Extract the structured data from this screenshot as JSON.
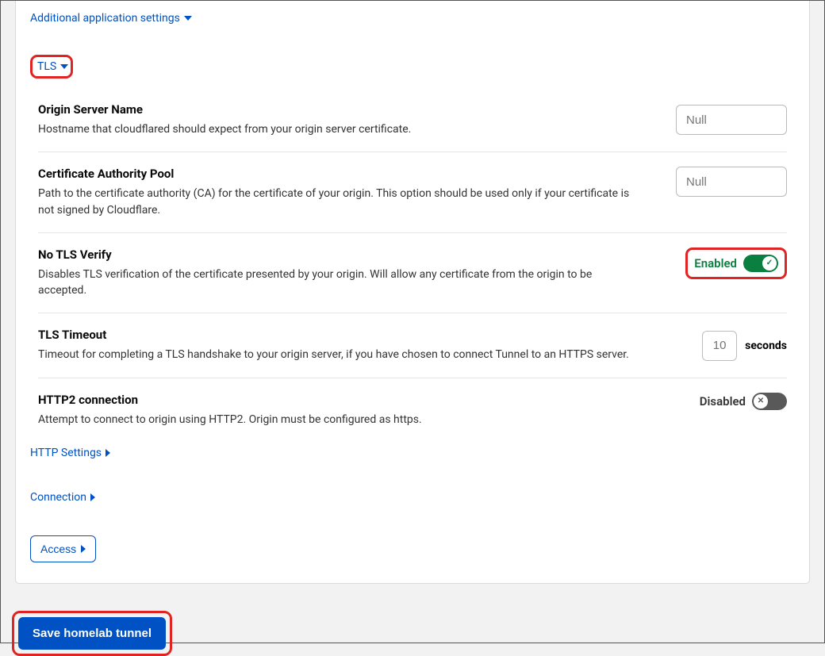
{
  "header_link": "Additional application settings",
  "section": "TLS",
  "rows": {
    "origin_server_name": {
      "title": "Origin Server Name",
      "desc": "Hostname that cloudflared should expect from your origin server certificate.",
      "placeholder": "Null"
    },
    "ca_pool": {
      "title": "Certificate Authority Pool",
      "desc": "Path to the certificate authority (CA) for the certificate of your origin. This option should be used only if your certificate is not signed by Cloudflare.",
      "placeholder": "Null"
    },
    "no_tls_verify": {
      "title": "No TLS Verify",
      "desc": "Disables TLS verification of the certificate presented by your origin. Will allow any certificate from the origin to be accepted.",
      "state_label": "Enabled"
    },
    "tls_timeout": {
      "title": "TLS Timeout",
      "desc": "Timeout for completing a TLS handshake to your origin server, if you have chosen to connect Tunnel to an HTTPS server.",
      "value": "10",
      "unit": "seconds"
    },
    "http2": {
      "title": "HTTP2 connection",
      "desc": "Attempt to connect to origin using HTTP2. Origin must be configured as https.",
      "state_label": "Disabled"
    }
  },
  "sub_links": {
    "http_settings": "HTTP Settings",
    "connection": "Connection"
  },
  "access_button": "Access",
  "save_button": "Save homelab tunnel"
}
